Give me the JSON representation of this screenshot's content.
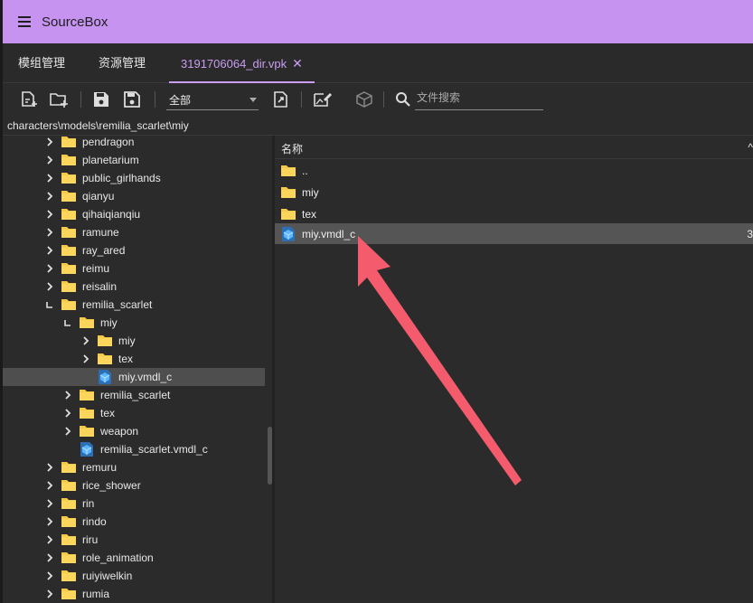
{
  "app": {
    "title": "SourceBox"
  },
  "tabs": [
    {
      "label": "模组管理"
    },
    {
      "label": "资源管理"
    },
    {
      "label": "3191706064_dir.vpk",
      "close": "✕"
    }
  ],
  "toolbar": {
    "filter_value": "全部",
    "search_placeholder": "文件搜索",
    "icons": [
      "new-file-icon",
      "new-folder-icon",
      "save-icon",
      "save-as-icon",
      "export-icon",
      "edit-image-icon",
      "package-icon",
      "search-icon"
    ]
  },
  "path": "characters\\models\\remilia_scarlet\\miy",
  "tree": [
    {
      "label": "pendragon"
    },
    {
      "label": "planetarium"
    },
    {
      "label": "public_girlhands"
    },
    {
      "label": "qianyu"
    },
    {
      "label": "qihaiqianqiu"
    },
    {
      "label": "ramune"
    },
    {
      "label": "ray_ared"
    },
    {
      "label": "reimu"
    },
    {
      "label": "reisalin"
    },
    {
      "label": "remilia_scarlet"
    },
    {
      "label": "miy"
    },
    {
      "label": "miy"
    },
    {
      "label": "tex"
    },
    {
      "label": "miy.vmdl_c"
    },
    {
      "label": "remilia_scarlet"
    },
    {
      "label": "tex"
    },
    {
      "label": "weapon"
    },
    {
      "label": "remilia_scarlet.vmdl_c"
    },
    {
      "label": "remuru"
    },
    {
      "label": "rice_shower"
    },
    {
      "label": "rin"
    },
    {
      "label": "rindo"
    },
    {
      "label": "riru"
    },
    {
      "label": "role_animation"
    },
    {
      "label": "ruiyiwelkin"
    },
    {
      "label": "rumia"
    }
  ],
  "list": {
    "header": "名称",
    "header_extra": "^",
    "rows": [
      {
        "label": "..",
        "extra": ""
      },
      {
        "label": "miy",
        "extra": ""
      },
      {
        "label": "tex",
        "extra": ""
      },
      {
        "label": "miy.vmdl_c",
        "extra": "3"
      }
    ]
  },
  "colors": {
    "accent": "#c99ef2",
    "titlebar": "#c694f0",
    "folder": "#f7c948",
    "model": "#4aa8f0",
    "arrow": "#f45c6e"
  }
}
